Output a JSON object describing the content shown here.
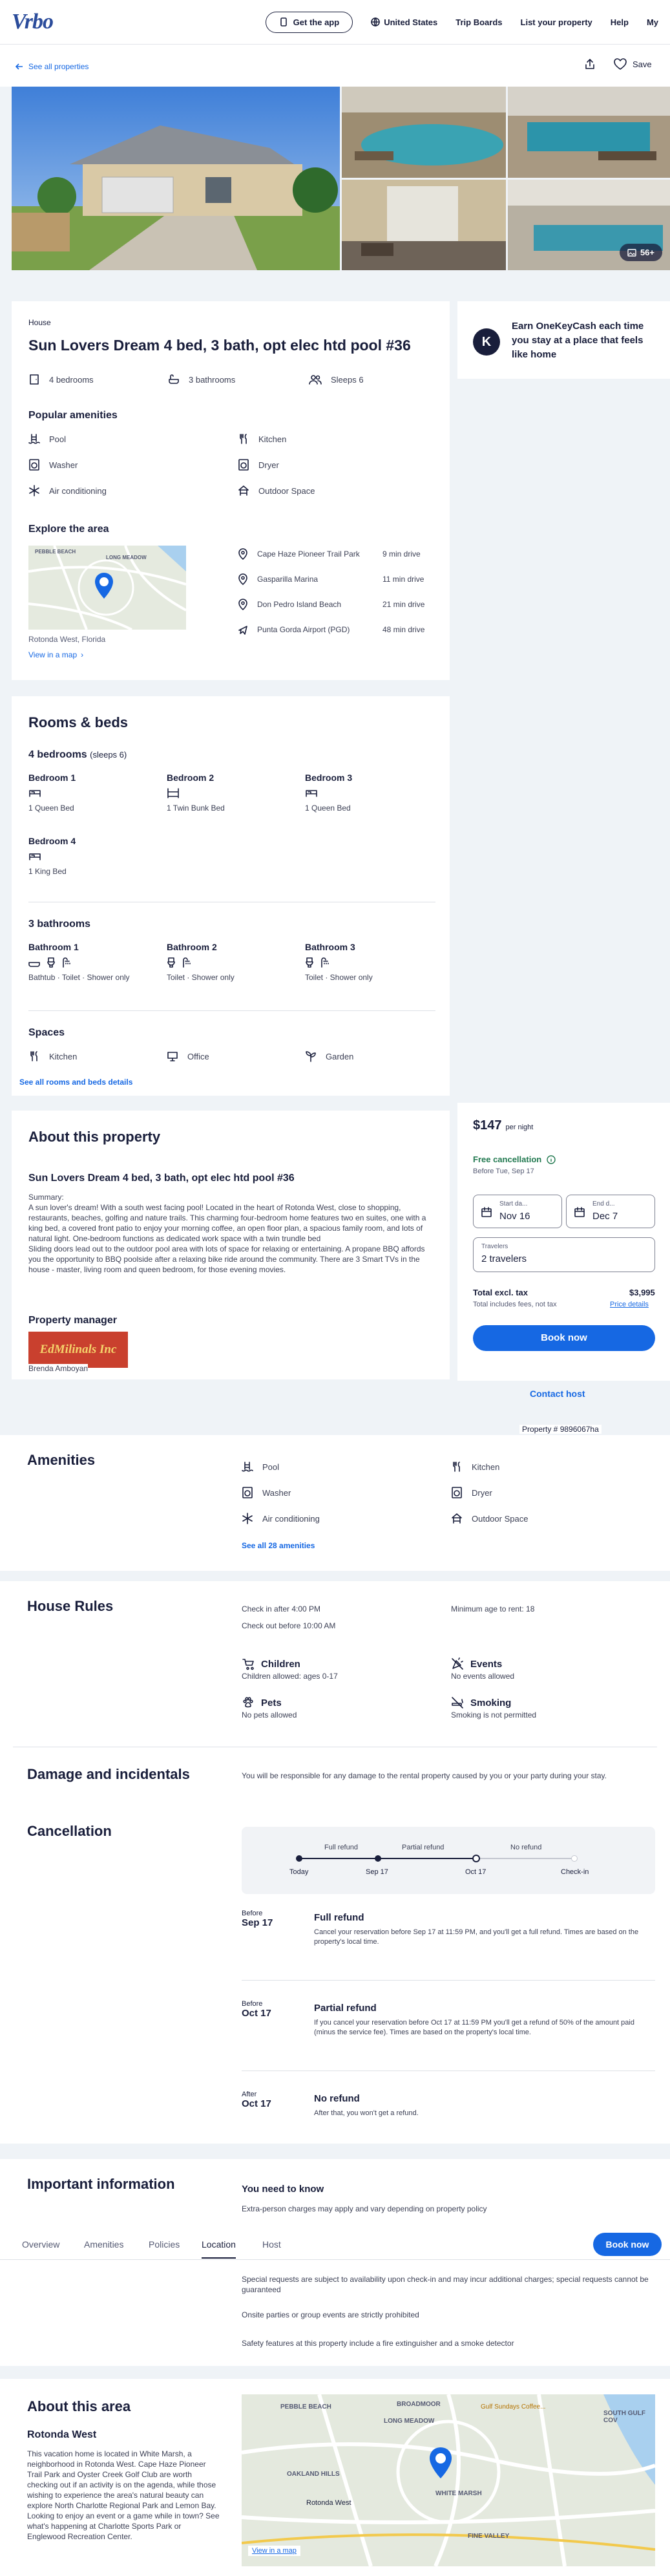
{
  "header": {
    "logo": "Vrbo",
    "get_app": "Get the app",
    "region": "United States",
    "trip_boards": "Trip Boards",
    "list_property": "List your property",
    "help": "Help",
    "account": "My"
  },
  "nav": {
    "see_all": "See all properties",
    "save": "Save"
  },
  "gallery": {
    "count": "56+"
  },
  "overview": {
    "type": "House",
    "title": "Sun Lovers Dream 4 bed, 3 bath, opt elec htd pool #36",
    "bedrooms": "4 bedrooms",
    "bathrooms": "3 bathrooms",
    "sleeps": "Sleeps 6"
  },
  "popular": {
    "heading": "Popular amenities",
    "items": [
      "Pool",
      "Kitchen",
      "Washer",
      "Dryer",
      "Air conditioning",
      "Outdoor Space"
    ]
  },
  "explore": {
    "heading": "Explore the area",
    "map_labels": [
      "PEBBLE BEACH",
      "LONG MEADOW"
    ],
    "location": "Rotonda West, Florida",
    "view_map": "View in a map",
    "places": [
      {
        "name": "Cape Haze Pioneer Trail Park",
        "time": "9 min drive"
      },
      {
        "name": "Gasparilla Marina",
        "time": "11 min drive"
      },
      {
        "name": "Don Pedro Island Beach",
        "time": "21 min drive"
      },
      {
        "name": "Punta Gorda Airport (PGD)",
        "time": "48 min drive"
      }
    ]
  },
  "onekey": {
    "text": "Earn OneKeyCash each time you stay at a place that feels like home",
    "badge": "K"
  },
  "rooms": {
    "heading": "Rooms & beds",
    "bed_heading": "4 bedrooms",
    "bed_sleeps": "(sleeps 6)",
    "bedrooms": [
      {
        "name": "Bedroom 1",
        "bed": "1 Queen Bed"
      },
      {
        "name": "Bedroom 2",
        "bed": "1 Twin Bunk Bed"
      },
      {
        "name": "Bedroom 3",
        "bed": "1 Queen Bed"
      },
      {
        "name": "Bedroom 4",
        "bed": "1 King Bed"
      }
    ],
    "bath_heading": "3 bathrooms",
    "bathrooms": [
      {
        "name": "Bathroom 1",
        "detail": "Bathtub · Toilet · Shower only"
      },
      {
        "name": "Bathroom 2",
        "detail": "Toilet · Shower only"
      },
      {
        "name": "Bathroom 3",
        "detail": "Toilet · Shower only"
      }
    ],
    "spaces_heading": "Spaces",
    "spaces": [
      "Kitchen",
      "Office",
      "Garden"
    ],
    "see_all": "See all rooms and beds details"
  },
  "about": {
    "heading": "About this property",
    "subtitle": "Sun Lovers Dream 4 bed, 3 bath, opt elec htd pool #36",
    "summary_label": "Summary:",
    "summary": "A sun lover's dream! With a south west facing pool! Located in the heart of Rotonda West, close to shopping, restaurants, beaches, golfing and nature trails. This charming four-bedroom home features two en suites, one with a king bed, a covered front patio to enjoy your morning coffee, an open floor plan, a spacious family room, and lots of natural light. One-bedroom functions as dedicated work space with a twin trundle bed",
    "summary2": "Sliding doors lead out to the outdoor pool area with lots of space for relaxing or entertaining. A propane BBQ affords you the opportunity to BBQ poolside after a relaxing bike ride around the community. There are 3 Smart TVs in the house - master, living room and queen bedroom, for those evening movies.",
    "manager_heading": "Property manager",
    "manager_logo": "EdMilinals Inc",
    "manager_name": "Brenda Amboyan"
  },
  "booking": {
    "price": "$147",
    "per": "per night",
    "free_cancel": "Free cancellation",
    "before": "Before Tue, Sep 17",
    "start_label": "Start da...",
    "start": "Nov 16",
    "end_label": "End d...",
    "end": "Dec 7",
    "travelers_label": "Travelers",
    "travelers": "2 travelers",
    "total_label": "Total excl. tax",
    "total": "$3,995",
    "fees": "Total includes fees, not tax",
    "price_details": "Price details",
    "book": "Book now",
    "contact": "Contact host",
    "property_num": "Property # 9896067ha"
  },
  "amenities": {
    "heading": "Amenities",
    "items": [
      "Pool",
      "Kitchen",
      "Washer",
      "Dryer",
      "Air conditioning",
      "Outdoor Space"
    ],
    "see_all": "See all 28 amenities"
  },
  "rules": {
    "heading": "House Rules",
    "checkin": "Check in after 4:00 PM",
    "checkout": "Check out before 10:00 AM",
    "min_age": "Minimum age to rent: 18",
    "children": "Children",
    "children_d": "Children allowed: ages 0-17",
    "events": "Events",
    "events_d": "No events allowed",
    "pets": "Pets",
    "pets_d": "No pets allowed",
    "smoking": "Smoking",
    "smoking_d": "Smoking is not permitted"
  },
  "damage": {
    "heading": "Damage and incidentals",
    "text": "You will be responsible for any damage to the rental property caused by you or your party during your stay."
  },
  "cancellation": {
    "heading": "Cancellation",
    "timeline": [
      "Full refund",
      "Partial refund",
      "No refund"
    ],
    "dates": [
      "Today",
      "Sep 17",
      "Oct 17",
      "Check-in"
    ],
    "items": [
      {
        "pre": "Before",
        "date": "Sep 17",
        "title": "Full refund",
        "text": "Cancel your reservation before Sep 17 at 11:59 PM, and you'll get a full refund. Times are based on the property's local time."
      },
      {
        "pre": "Before",
        "date": "Oct 17",
        "title": "Partial refund",
        "text": "If you cancel your reservation before Oct 17 at 11:59 PM you'll get a refund of 50% of the amount paid (minus the service fee). Times are based on the property's local time."
      },
      {
        "pre": "After",
        "date": "Oct 17",
        "title": "No refund",
        "text": "After that, you won't get a refund."
      }
    ]
  },
  "important": {
    "heading": "Important information",
    "need": "You need to know",
    "line1": "Extra-person charges may apply and vary depending on property policy",
    "line2": "Special requests are subject to availability upon check-in and may incur additional charges; special requests cannot be guaranteed",
    "line3": "Onsite parties or group events are strictly prohibited",
    "line4": "Safety features at this property include a fire extinguisher and a smoke detector"
  },
  "tabs": {
    "items": [
      "Overview",
      "Amenities",
      "Policies",
      "Location",
      "Host"
    ],
    "book": "Book now"
  },
  "area": {
    "heading": "About this area",
    "sub": "Rotonda West",
    "text": "This vacation home is located in White Marsh, a neighborhood in Rotonda West. Cape Haze Pioneer Trail Park and Oyster Creek Golf Club are worth checking out if an activity is on the agenda, while those wishing to experience the area's natural beauty can explore North Charlotte Regional Park and Lemon Bay. Looking to enjoy an event or a game while in town? See what's happening at Charlotte Sports Park or Englewood Recreation Center.",
    "map_labels": [
      "PEBBLE BEACH",
      "BROADMOOR",
      "LONG MEADOW",
      "OAKLAND HILLS",
      "WHITE MARSH",
      "Rotonda West",
      "FINE VALLEY",
      "SOUTH GULF COV"
    ],
    "view_map": "View in a map",
    "gulf": "Gulf Sundays Coffee..."
  }
}
